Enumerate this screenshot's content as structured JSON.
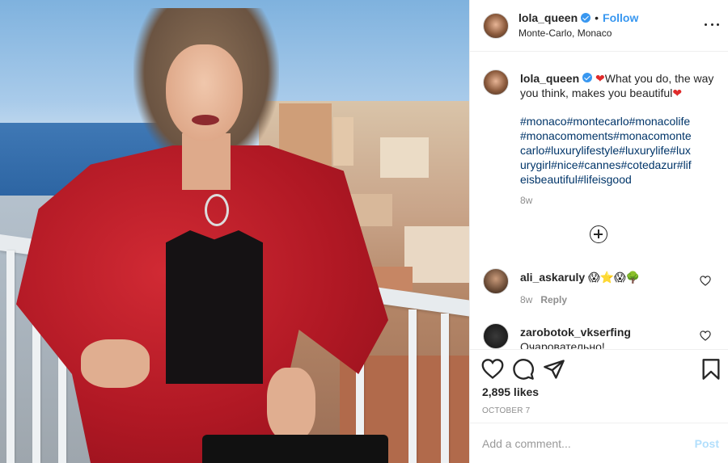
{
  "post": {
    "username": "lola_queen",
    "follow_label": "Follow",
    "separator": "•",
    "location": "Monte-Carlo, Monaco",
    "caption_text": "What you do, the way you think, makes you beautiful",
    "caption_heart": "❤",
    "hashtags": "#monaco#montecarlo#monacolife#monacomoments#monacomontecarlo#luxurylifestyle#luxurylife#luxurygirl#nice#cannes#cotedazur#lifeisbeautiful#lifeisgood",
    "caption_age": "8w"
  },
  "comments": [
    {
      "username": "ali_askaruly",
      "text": "😱⭐😱🌳",
      "age": "8w",
      "reply_label": "Reply"
    },
    {
      "username": "zarobotok_vkserfing",
      "text": "Очаровательно!"
    }
  ],
  "actions": {
    "likes": "2,895 likes",
    "date": "OCTOBER 7",
    "comment_placeholder": "Add a comment...",
    "post_label": "Post"
  },
  "icons": {
    "verified": "verified-badge-icon",
    "more": "more-options-icon",
    "add": "plus-circle-icon",
    "like": "heart-icon",
    "comment": "comment-icon",
    "share": "paper-plane-icon",
    "save": "bookmark-icon"
  },
  "colors": {
    "link": "#3897f0",
    "hashtag": "#003569",
    "muted": "#8e8e8e",
    "post_disabled": "#b2dffc"
  }
}
